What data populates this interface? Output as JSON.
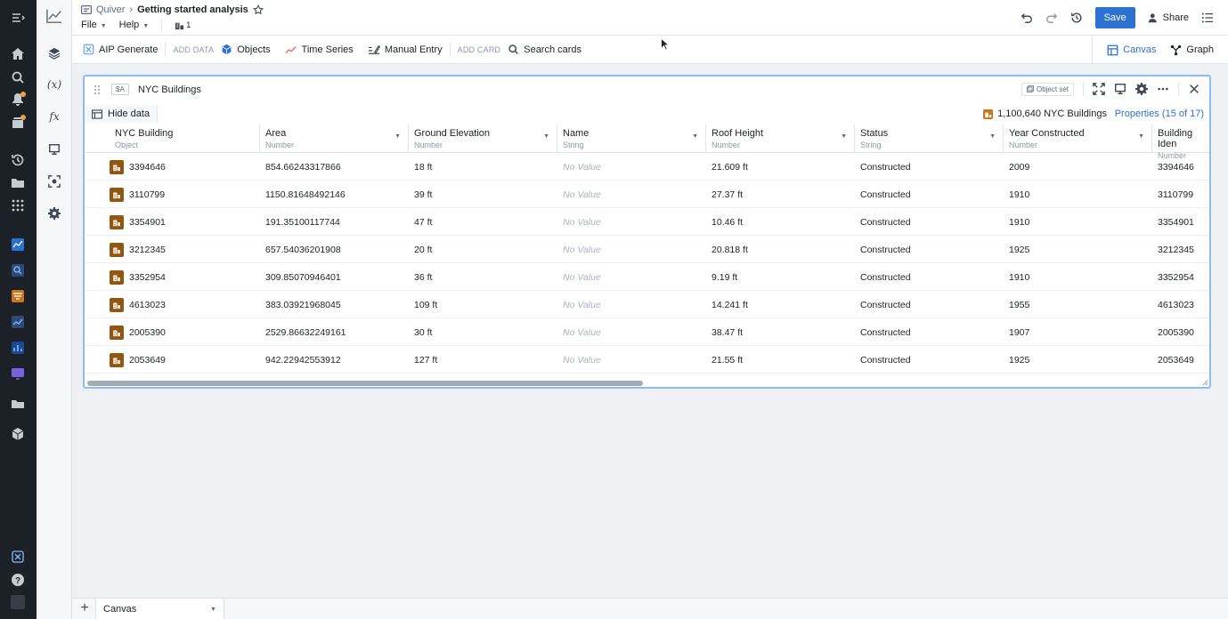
{
  "header": {
    "app": "Quiver",
    "title": "Getting started analysis",
    "menus": [
      "File",
      "Help"
    ],
    "branch_count": "1",
    "save_label": "Save",
    "share_label": "Share"
  },
  "toolbar": {
    "aip_generate": "AIP Generate",
    "add_data_label": "ADD DATA",
    "objects": "Objects",
    "time_series": "Time Series",
    "manual_entry": "Manual Entry",
    "add_card_label": "ADD CARD",
    "search_cards": "Search cards",
    "canvas": "Canvas",
    "graph": "Graph"
  },
  "card": {
    "var_tag": "$A",
    "title": "NYC Buildings",
    "object_set_label": "Object set",
    "hide_data": "Hide data",
    "count": "1,100,640 NYC Buildings",
    "properties": "Properties (15 of 17)"
  },
  "table": {
    "columns": [
      {
        "name": "NYC Building",
        "type": "Object",
        "sortable": false
      },
      {
        "name": "Area",
        "type": "Number",
        "sortable": true
      },
      {
        "name": "Ground Elevation",
        "type": "Number",
        "sortable": true
      },
      {
        "name": "Name",
        "type": "String",
        "sortable": true
      },
      {
        "name": "Roof Height",
        "type": "Number",
        "sortable": true
      },
      {
        "name": "Status",
        "type": "String",
        "sortable": true
      },
      {
        "name": "Year Constructed",
        "type": "Number",
        "sortable": true
      },
      {
        "name": "Building Iden",
        "type": "Number",
        "sortable": false
      }
    ],
    "rows": [
      [
        "3394646",
        "854.66243317866",
        "18 ft",
        "No Value",
        "21.609 ft",
        "Constructed",
        "2009",
        "3394646"
      ],
      [
        "3110799",
        "1150.81648492146",
        "39 ft",
        "No Value",
        "27.37 ft",
        "Constructed",
        "1910",
        "3110799"
      ],
      [
        "3354901",
        "191.35100117744",
        "47 ft",
        "No Value",
        "10.46 ft",
        "Constructed",
        "1910",
        "3354901"
      ],
      [
        "3212345",
        "657.54036201908",
        "20 ft",
        "No Value",
        "20.818 ft",
        "Constructed",
        "1925",
        "3212345"
      ],
      [
        "3352954",
        "309.85070946401",
        "36 ft",
        "No Value",
        "9.19 ft",
        "Constructed",
        "1910",
        "3352954"
      ],
      [
        "4613023",
        "383.03921968045",
        "109 ft",
        "No Value",
        "14.241 ft",
        "Constructed",
        "1955",
        "4613023"
      ],
      [
        "2005390",
        "2529.86632249161",
        "30 ft",
        "No Value",
        "38.47 ft",
        "Constructed",
        "1907",
        "2005390"
      ],
      [
        "2053649",
        "942.22942553912",
        "127 ft",
        "No Value",
        "21.55 ft",
        "Constructed",
        "1925",
        "2053649"
      ]
    ]
  },
  "bottom": {
    "page_tab": "Canvas"
  },
  "colors": {
    "accent": "#2d72d2",
    "rail": "#1c2127",
    "object_badge": "#935610",
    "card_border": "#8abbff"
  }
}
